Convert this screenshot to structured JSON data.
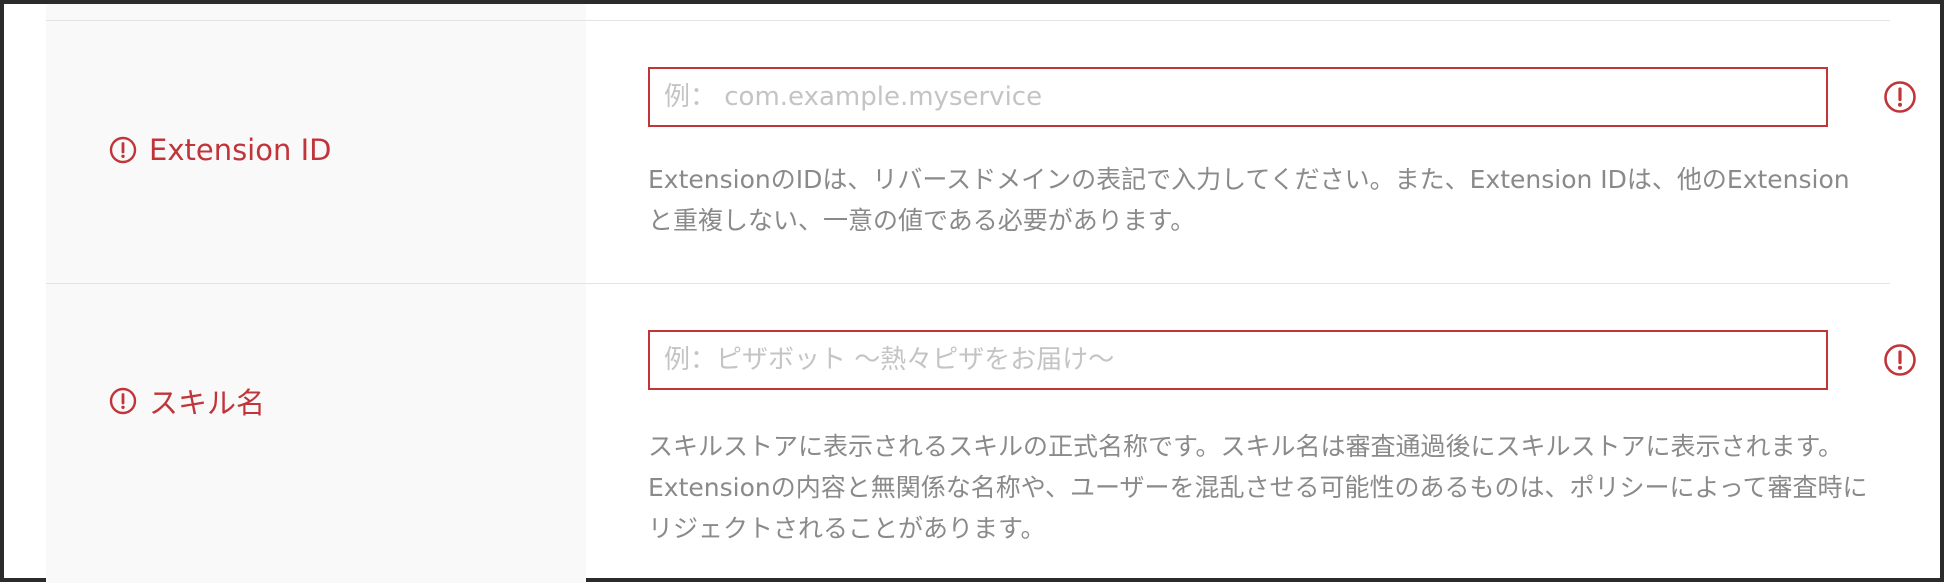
{
  "colors": {
    "error": "#c0353a",
    "label_bg": "#f9f9f9",
    "help_text": "#8a8a8a",
    "placeholder": "#c4c4c4",
    "divider": "#e3e3e3"
  },
  "form": {
    "fields": [
      {
        "label": "Extension ID",
        "label_icon": "alert-circle-icon",
        "input_value": "",
        "placeholder": "例： com.example.myservice",
        "status_icon": "alert-circle-icon",
        "help_text": "ExtensionのIDは、リバースドメインの表記で入力してください。また、Extension IDは、他のExtensionと重複しない、一意の値である必要があります。"
      },
      {
        "label": "スキル名",
        "label_icon": "alert-circle-icon",
        "input_value": "",
        "placeholder": "例：ピザボット 〜熱々ピザをお届け〜",
        "status_icon": "alert-circle-icon",
        "help_text": "スキルストアに表示されるスキルの正式名称です。スキル名は審査通過後にスキルストアに表示されます。Extensionの内容と無関係な名称や、ユーザーを混乱させる可能性のあるものは、ポリシーによって審査時にリジェクトされることがあります。"
      }
    ]
  }
}
